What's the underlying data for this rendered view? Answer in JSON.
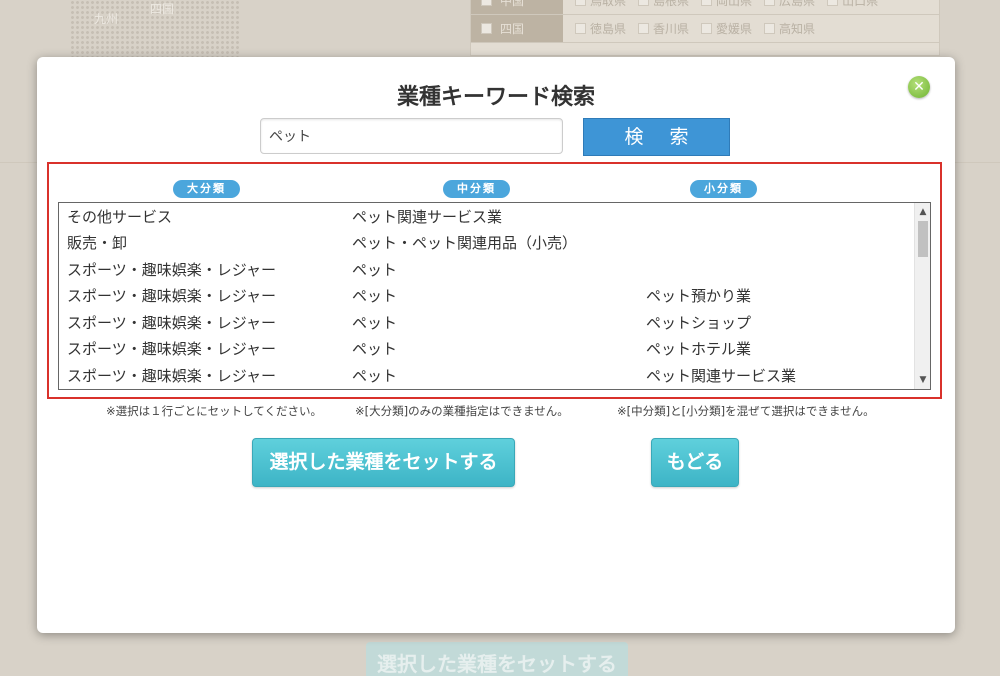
{
  "background": {
    "map_labels": [
      "九州",
      "四国"
    ],
    "region_rows": [
      {
        "region": "中国",
        "prefectures": [
          "鳥取県",
          "島根県",
          "岡山県",
          "広島県",
          "山口県"
        ]
      },
      {
        "region": "四国",
        "prefectures": [
          "徳島県",
          "香川県",
          "愛媛県",
          "高知県"
        ]
      }
    ],
    "bottom_button_label": "選択した業種をセットする"
  },
  "modal": {
    "title": "業種キーワード検索",
    "close_icon": "close-x-icon",
    "search": {
      "value": "ペット",
      "button_label": "検 索"
    },
    "columns": {
      "major": "大分類",
      "middle": "中分類",
      "minor": "小分類"
    },
    "rows": [
      {
        "major": "その他サービス",
        "middle": "ペット関連サービス業",
        "minor": ""
      },
      {
        "major": "販売・卸",
        "middle": "ペット・ペット関連用品（小売）",
        "minor": ""
      },
      {
        "major": "スポーツ・趣味娯楽・レジャー",
        "middle": "ペット",
        "minor": ""
      },
      {
        "major": "スポーツ・趣味娯楽・レジャー",
        "middle": "ペット",
        "minor": "ペット預かり業"
      },
      {
        "major": "スポーツ・趣味娯楽・レジャー",
        "middle": "ペット",
        "minor": "ペットショップ"
      },
      {
        "major": "スポーツ・趣味娯楽・レジャー",
        "middle": "ペット",
        "minor": "ペットホテル業"
      },
      {
        "major": "スポーツ・趣味娯楽・レジャー",
        "middle": "ペット",
        "minor": "ペット関連サービス業"
      }
    ],
    "notes": [
      "※選択は１行ごとにセットしてください。",
      "※[大分類]のみの業種指定はできません。",
      "※[中分類]と[小分類]を混ぜて選択はできません。"
    ],
    "set_button_label": "選択した業種をセットする",
    "back_button_label": "もどる"
  }
}
